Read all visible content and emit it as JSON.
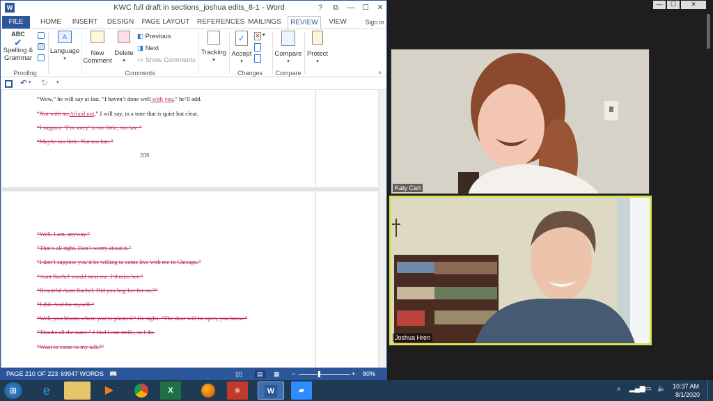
{
  "word": {
    "title": "KWC full draft in sections_joshua edits_8-1 - Word",
    "window_buttons": [
      "?",
      "⧉",
      "—",
      "☐",
      "✕"
    ],
    "signin": "Sign in",
    "tabs": [
      "FILE",
      "HOME",
      "INSERT",
      "DESIGN",
      "PAGE LAYOUT",
      "REFERENCES",
      "MAILINGS",
      "REVIEW",
      "VIEW"
    ],
    "active_tab": "REVIEW",
    "ribbon": {
      "spelling_top": "ABC",
      "spelling": "Spelling &",
      "grammar": "Grammar",
      "language": "Language",
      "new_comment_1": "New",
      "new_comment_2": "Comment",
      "delete": "Delete",
      "previous": "Previous",
      "next": "Next",
      "show_comments": "Show Comments",
      "tracking": "Tracking",
      "accept": "Accept",
      "compare": "Compare",
      "protect": "Protect",
      "groups": [
        "Proofing",
        "Comments",
        "Changes",
        "Compare"
      ]
    },
    "page1": [
      {
        "parts": [
          {
            "t": "“Wow,” he will say at last. “I haven’t done well",
            "s": "n"
          },
          {
            "t": " with you",
            "s": "ins"
          },
          {
            "t": ",” he’ll add.",
            "s": "n"
          }
        ]
      },
      {
        "parts": [
          {
            "t": "“",
            "s": "n"
          },
          {
            "t": "Not with me",
            "s": "del"
          },
          {
            "t": "Afraid not",
            "s": "ins"
          },
          {
            "t": ",” I will say, in a tone that is quiet but clear.",
            "s": "n"
          }
        ]
      },
      {
        "parts": [
          {
            "t": "“I suppose ‘I’m sorry’ is too little, too late.”",
            "s": "del"
          }
        ]
      },
      {
        "parts": [
          {
            "t": "“Maybe too little. Not too late.”",
            "s": "del"
          }
        ]
      }
    ],
    "page_number": "209",
    "page2": [
      "“Well, I am, anyway.”",
      "“That’s all right. Don’t worry about it.”",
      "“I don’t suppose you’d be willing to come live with me in Chicago.”",
      "“Aunt Rachel would miss me. I’d miss her.”",
      "“Beautiful Aunt Rachel. Did you hug her for me?”",
      "“I did. And for myself.”",
      "“Well, you bloom where you’re planted.” He sighs. “The door will be open, you know.”",
      "“Thanks all the same.” I find I can smile, so I do.",
      "“Want to come to my talk?”"
    ],
    "status": {
      "page": "PAGE 210 OF 223",
      "words": "69947 WORDS",
      "zoom": "80%",
      "zoom_level": 0.8
    }
  },
  "zoom": {
    "participants": [
      {
        "name": "Katy Carl",
        "active": false
      },
      {
        "name": "Joshua Hren",
        "active": true
      }
    ],
    "active_border_color": "#d7e353"
  },
  "taskbar": {
    "time": "10:37 AM",
    "date": "8/1/2020",
    "apps": [
      "start",
      "ie",
      "explorer",
      "media",
      "chrome",
      "excel",
      "firefox",
      "acrobat",
      "word",
      "zoom"
    ]
  }
}
